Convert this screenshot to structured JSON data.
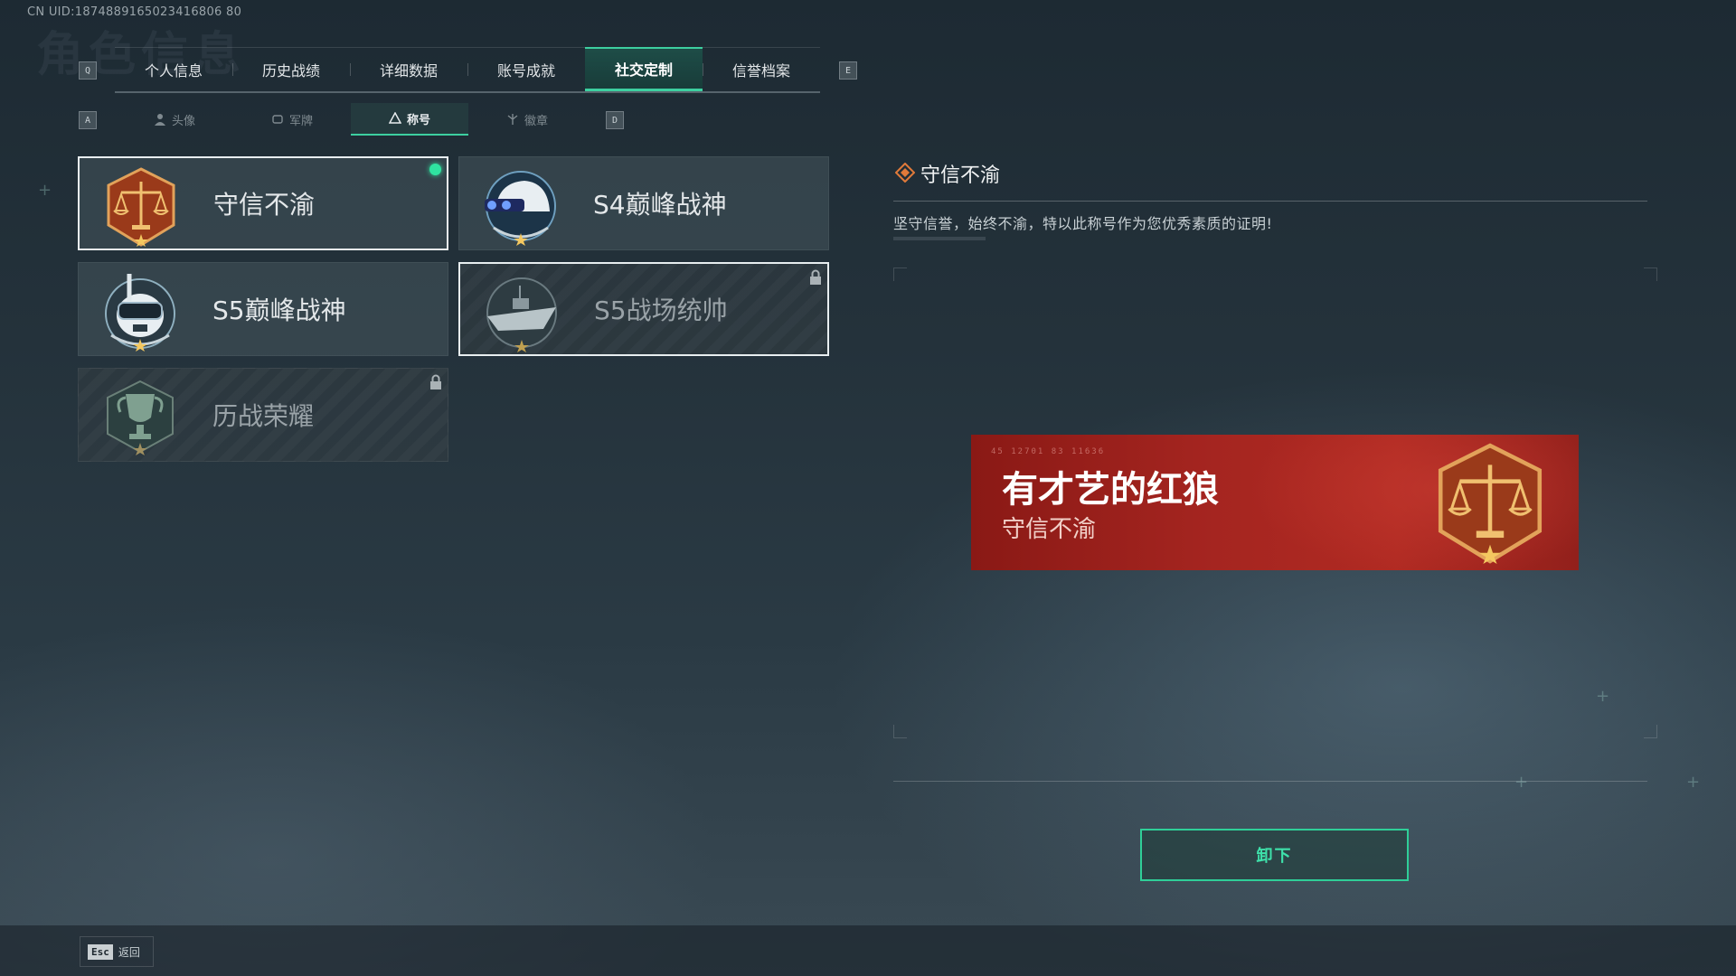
{
  "header": {
    "uid": "CN UID:1874889165023416806 80",
    "bg_title": "角色信息"
  },
  "keys": {
    "prev_tab": "Q",
    "next_tab": "E",
    "prev_sub": "A",
    "next_sub": "D"
  },
  "tabs": [
    {
      "label": "个人信息",
      "active": false
    },
    {
      "label": "历史战绩",
      "active": false
    },
    {
      "label": "详细数据",
      "active": false
    },
    {
      "label": "账号成就",
      "active": false
    },
    {
      "label": "社交定制",
      "active": true
    },
    {
      "label": "信誉档案",
      "active": false
    }
  ],
  "subtabs": [
    {
      "label": "头像",
      "icon": "person-icon",
      "active": false
    },
    {
      "label": "军牌",
      "icon": "dogtag-icon",
      "active": false
    },
    {
      "label": "称号",
      "icon": "title-icon",
      "active": true
    },
    {
      "label": "徽章",
      "icon": "badge-icon",
      "active": false
    }
  ],
  "titles": [
    {
      "name": "守信不渝",
      "emblem": "scales-emblem-icon",
      "equipped": true,
      "locked": false,
      "selected": true
    },
    {
      "name": "S4巅峰战神",
      "emblem": "helmet-emblem-icon",
      "equipped": false,
      "locked": false,
      "selected": false
    },
    {
      "name": "S5巅峰战神",
      "emblem": "diver-skull-emblem-icon",
      "equipped": false,
      "locked": false,
      "selected": false
    },
    {
      "name": "S5战场统帅",
      "emblem": "boat-emblem-icon",
      "equipped": false,
      "locked": true,
      "selected": true
    },
    {
      "name": "历战荣耀",
      "emblem": "trophy-emblem-icon",
      "equipped": false,
      "locked": true,
      "selected": false
    }
  ],
  "detail": {
    "title": "守信不渝",
    "description": "坚守信誉，始终不渝，特以此称号作为您优秀素质的证明!"
  },
  "banner": {
    "player_name": "有才艺的红狼",
    "title": "守信不渝",
    "deco_text": "45 12701 83 11636"
  },
  "actions": {
    "unequip_label": "卸下"
  },
  "footer": {
    "esc_key": "Esc",
    "back_label": "返回"
  },
  "colors": {
    "accent": "#3dcfa0",
    "banner_red": "#a52520",
    "equipped_dot": "#2fe3a0"
  }
}
